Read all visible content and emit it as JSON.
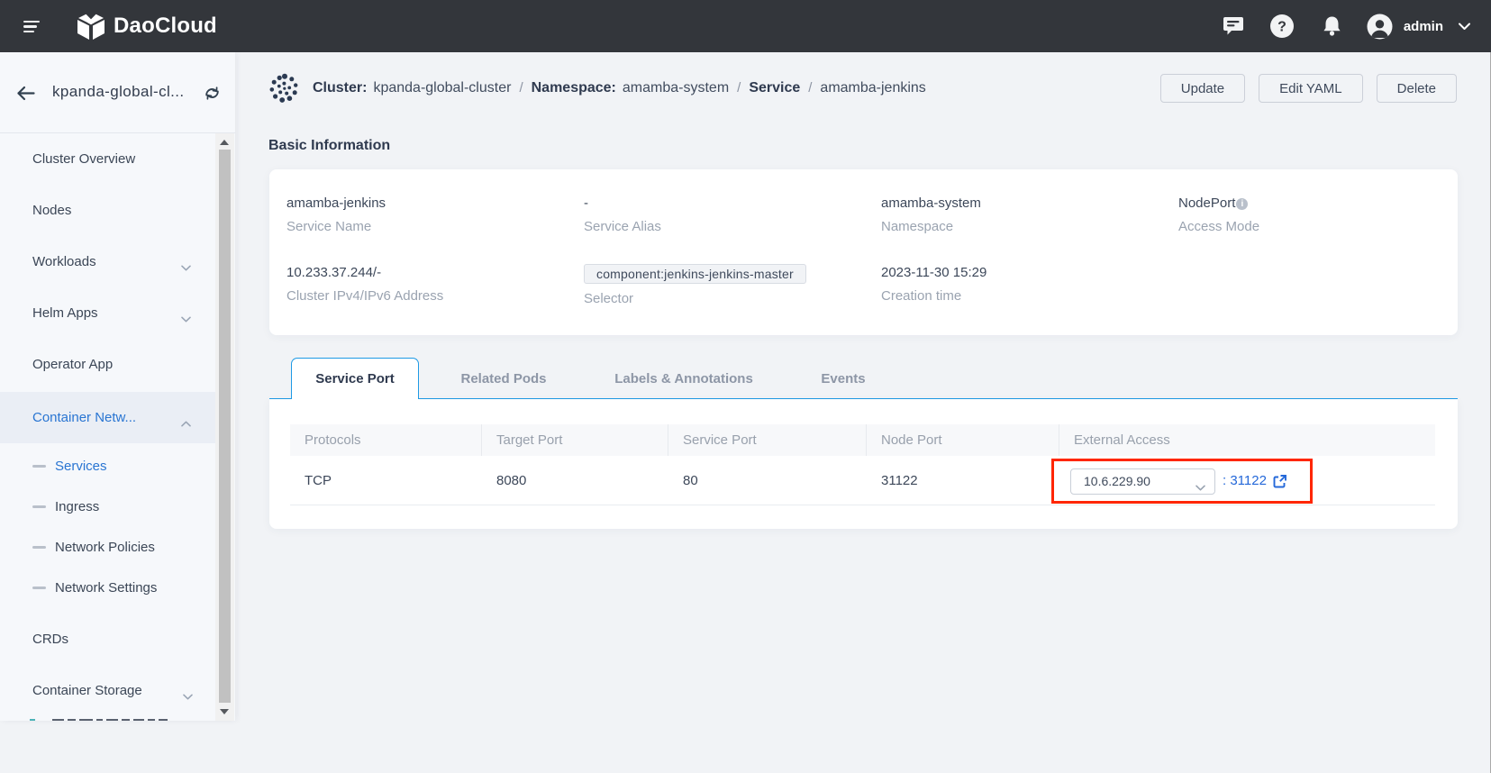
{
  "topbar": {
    "brand": "DaoCloud",
    "user_label": "admin"
  },
  "sidebar": {
    "cluster_name": "kpanda-global-cl...",
    "items": [
      {
        "label": "Cluster Overview"
      },
      {
        "label": "Nodes"
      },
      {
        "label": "Workloads"
      },
      {
        "label": "Helm Apps"
      },
      {
        "label": "Operator App"
      },
      {
        "label": "Container Netw..."
      },
      {
        "label": "Services"
      },
      {
        "label": "Ingress"
      },
      {
        "label": "Network Policies"
      },
      {
        "label": "Network Settings"
      },
      {
        "label": "CRDs"
      },
      {
        "label": "Container Storage"
      }
    ]
  },
  "breadcrumb": {
    "cluster_key": "Cluster:",
    "cluster_value": "kpanda-global-cluster",
    "sep": "/",
    "namespace_key": "Namespace:",
    "namespace_value": "amamba-system",
    "resource_type": "Service",
    "resource_name": "amamba-jenkins"
  },
  "actions": {
    "update": "Update",
    "edit_yaml": "Edit YAML",
    "delete": "Delete"
  },
  "basic_info": {
    "title": "Basic Information",
    "fields": [
      {
        "value": "amamba-jenkins",
        "label": "Service Name"
      },
      {
        "value": "-",
        "label": "Service Alias"
      },
      {
        "value": "amamba-system",
        "label": "Namespace"
      },
      {
        "value": "NodePort",
        "label": "Access Mode"
      },
      {
        "value": "10.233.37.244/-",
        "label": "Cluster IPv4/IPv6 Address"
      },
      {
        "value": "component:jenkins-jenkins-master",
        "label": "Selector"
      },
      {
        "value": "2023-11-30 15:29",
        "label": "Creation time"
      }
    ]
  },
  "tabs": [
    {
      "label": "Service Port",
      "active": true
    },
    {
      "label": "Related Pods",
      "active": false
    },
    {
      "label": "Labels & Annotations",
      "active": false
    },
    {
      "label": "Events",
      "active": false
    }
  ],
  "service_table": {
    "columns": [
      "Protocols",
      "Target Port",
      "Service Port",
      "Node Port",
      "External Access"
    ],
    "row": {
      "protocol": "TCP",
      "target_port": "8080",
      "service_port": "80",
      "node_port": "31122"
    },
    "external_access": {
      "ip": "10.6.229.90",
      "port": ": 31122"
    }
  },
  "colors": {
    "topbar_bg": "#33363b",
    "accent_blue": "#2975d2",
    "tab_blue": "#1e9ae5",
    "link_blue": "#2468d9",
    "highlight_red": "#ff2600"
  }
}
